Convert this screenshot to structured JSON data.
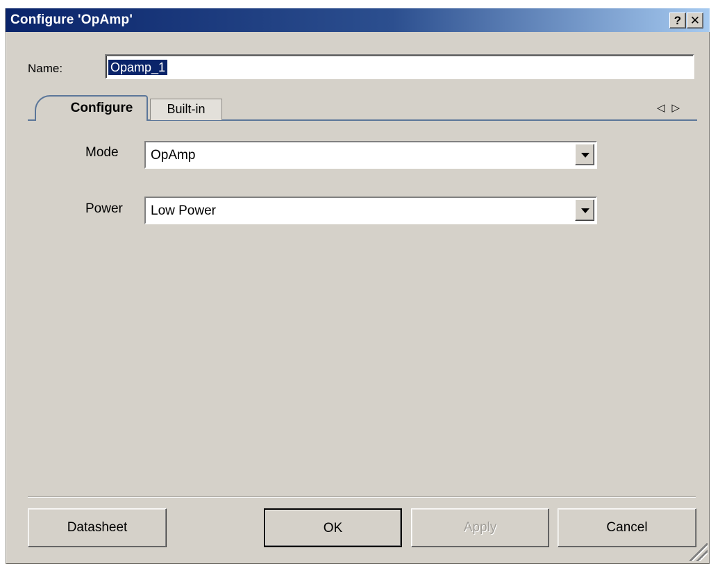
{
  "window": {
    "title": "Configure 'OpAmp'",
    "help_label": "?",
    "close_label": "✕"
  },
  "name_row": {
    "label": "Name:",
    "value": "Opamp_1"
  },
  "tabs": [
    {
      "label": "Configure",
      "active": true
    },
    {
      "label": "Built-in",
      "active": false
    }
  ],
  "tab_scroll": {
    "left": "◁",
    "right": "▷"
  },
  "form": {
    "mode": {
      "label": "Mode",
      "value": "OpAmp"
    },
    "power": {
      "label": "Power",
      "value": "Low Power"
    }
  },
  "buttons": {
    "datasheet": "Datasheet",
    "ok": "OK",
    "apply": "Apply",
    "cancel": "Cancel"
  },
  "colors": {
    "titlebar_start": "#0a246a",
    "titlebar_end": "#a6caf0",
    "dialog_face": "#d5d1c9",
    "selection": "#0a246a",
    "tab_border": "#5b7699"
  }
}
